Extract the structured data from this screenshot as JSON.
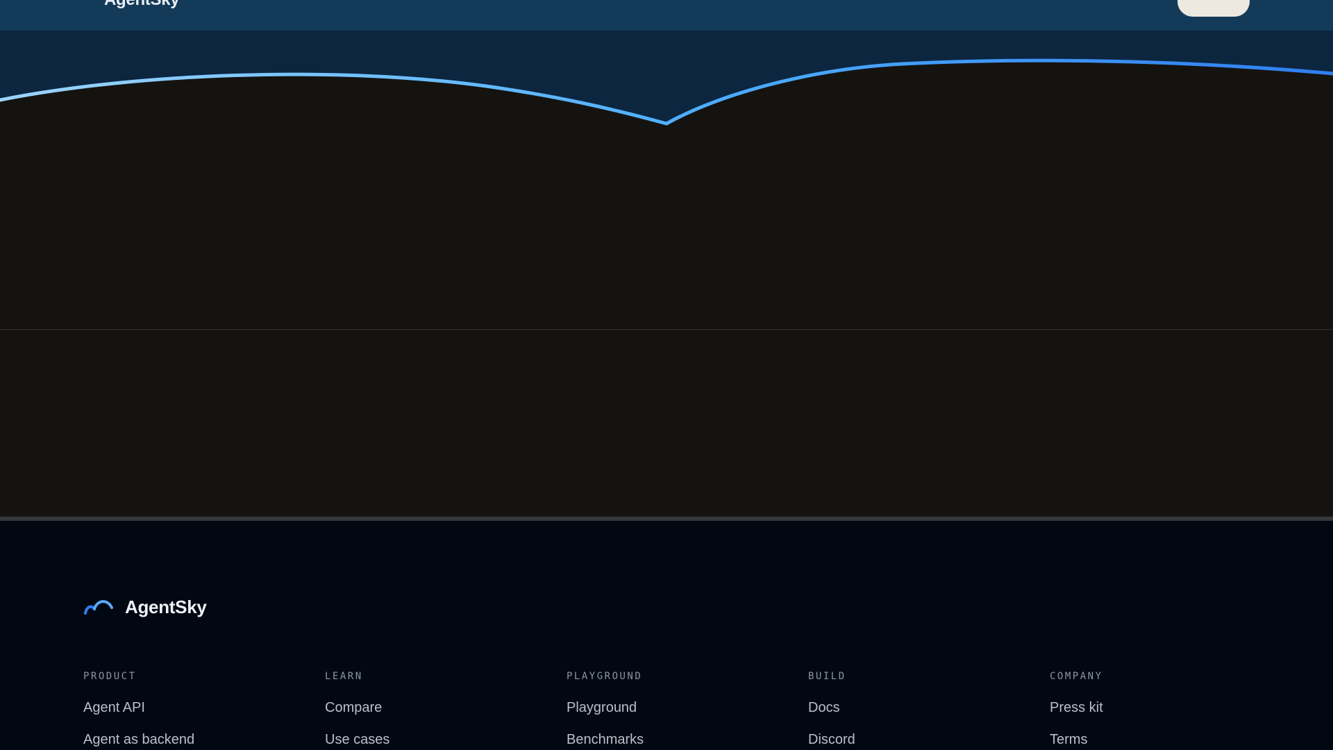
{
  "nav": {
    "brand": "AgentSky"
  },
  "colors": {
    "nav_bg": "#133a59",
    "sky_bg": "#0c2640",
    "dark_band": "#151310",
    "footer_bg": "#020812",
    "accent_blue": "#3b82f6",
    "light_blue": "#7cc4ff",
    "cta_bg": "#ede9e0"
  },
  "footer": {
    "brand": {
      "name": "AgentSky",
      "logo_icon": "cloud-arc-icon"
    },
    "columns": [
      {
        "heading": "PRODUCT",
        "links": [
          "Agent API",
          "Agent as backend"
        ]
      },
      {
        "heading": "LEARN",
        "links": [
          "Compare",
          "Use cases"
        ]
      },
      {
        "heading": "PLAYGROUND",
        "links": [
          "Playground",
          "Benchmarks"
        ]
      },
      {
        "heading": "BUILD",
        "links": [
          "Docs",
          "Discord"
        ]
      },
      {
        "heading": "COMPANY",
        "links": [
          "Press kit",
          "Terms"
        ]
      }
    ]
  }
}
